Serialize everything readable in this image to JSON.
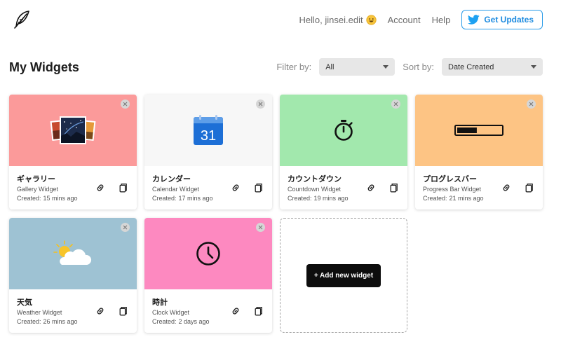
{
  "header": {
    "greeting": "Hello, jinsei.edit",
    "nav": {
      "account": "Account",
      "help": "Help"
    },
    "get_updates": "Get Updates",
    "twitter_color": "#1da1f2"
  },
  "page": {
    "title": "My Widgets"
  },
  "controls": {
    "filter_label": "Filter by:",
    "filter_value": "All",
    "sort_label": "Sort by:",
    "sort_value": "Date Created"
  },
  "created_prefix": "Created:",
  "widgets": [
    {
      "name": "ギャラリー",
      "type": "Gallery Widget",
      "created": "15 mins ago",
      "color": "#fb9a9a",
      "icon": "gallery-icon"
    },
    {
      "name": "カレンダー",
      "type": "Calendar Widget",
      "created": "17 mins ago",
      "color": "#f7f7f7",
      "icon": "calendar-icon",
      "calendar_day": "31"
    },
    {
      "name": "カウントダウン",
      "type": "Countdown Widget",
      "created": "19 mins ago",
      "color": "#a2e8ad",
      "icon": "stopwatch-icon"
    },
    {
      "name": "プログレスバー",
      "type": "Progress Bar Widget",
      "created": "21 mins ago",
      "color": "#fdc484",
      "icon": "progress-bar-icon",
      "progress": 0.45
    },
    {
      "name": "天気",
      "type": "Weather Widget",
      "created": "26 mins ago",
      "color": "#9ec2d3",
      "icon": "weather-icon"
    },
    {
      "name": "時計",
      "type": "Clock Widget",
      "created": "2 days ago",
      "color": "#fd89c0",
      "icon": "clock-icon"
    }
  ],
  "add_widget_label": "+ Add new widget"
}
